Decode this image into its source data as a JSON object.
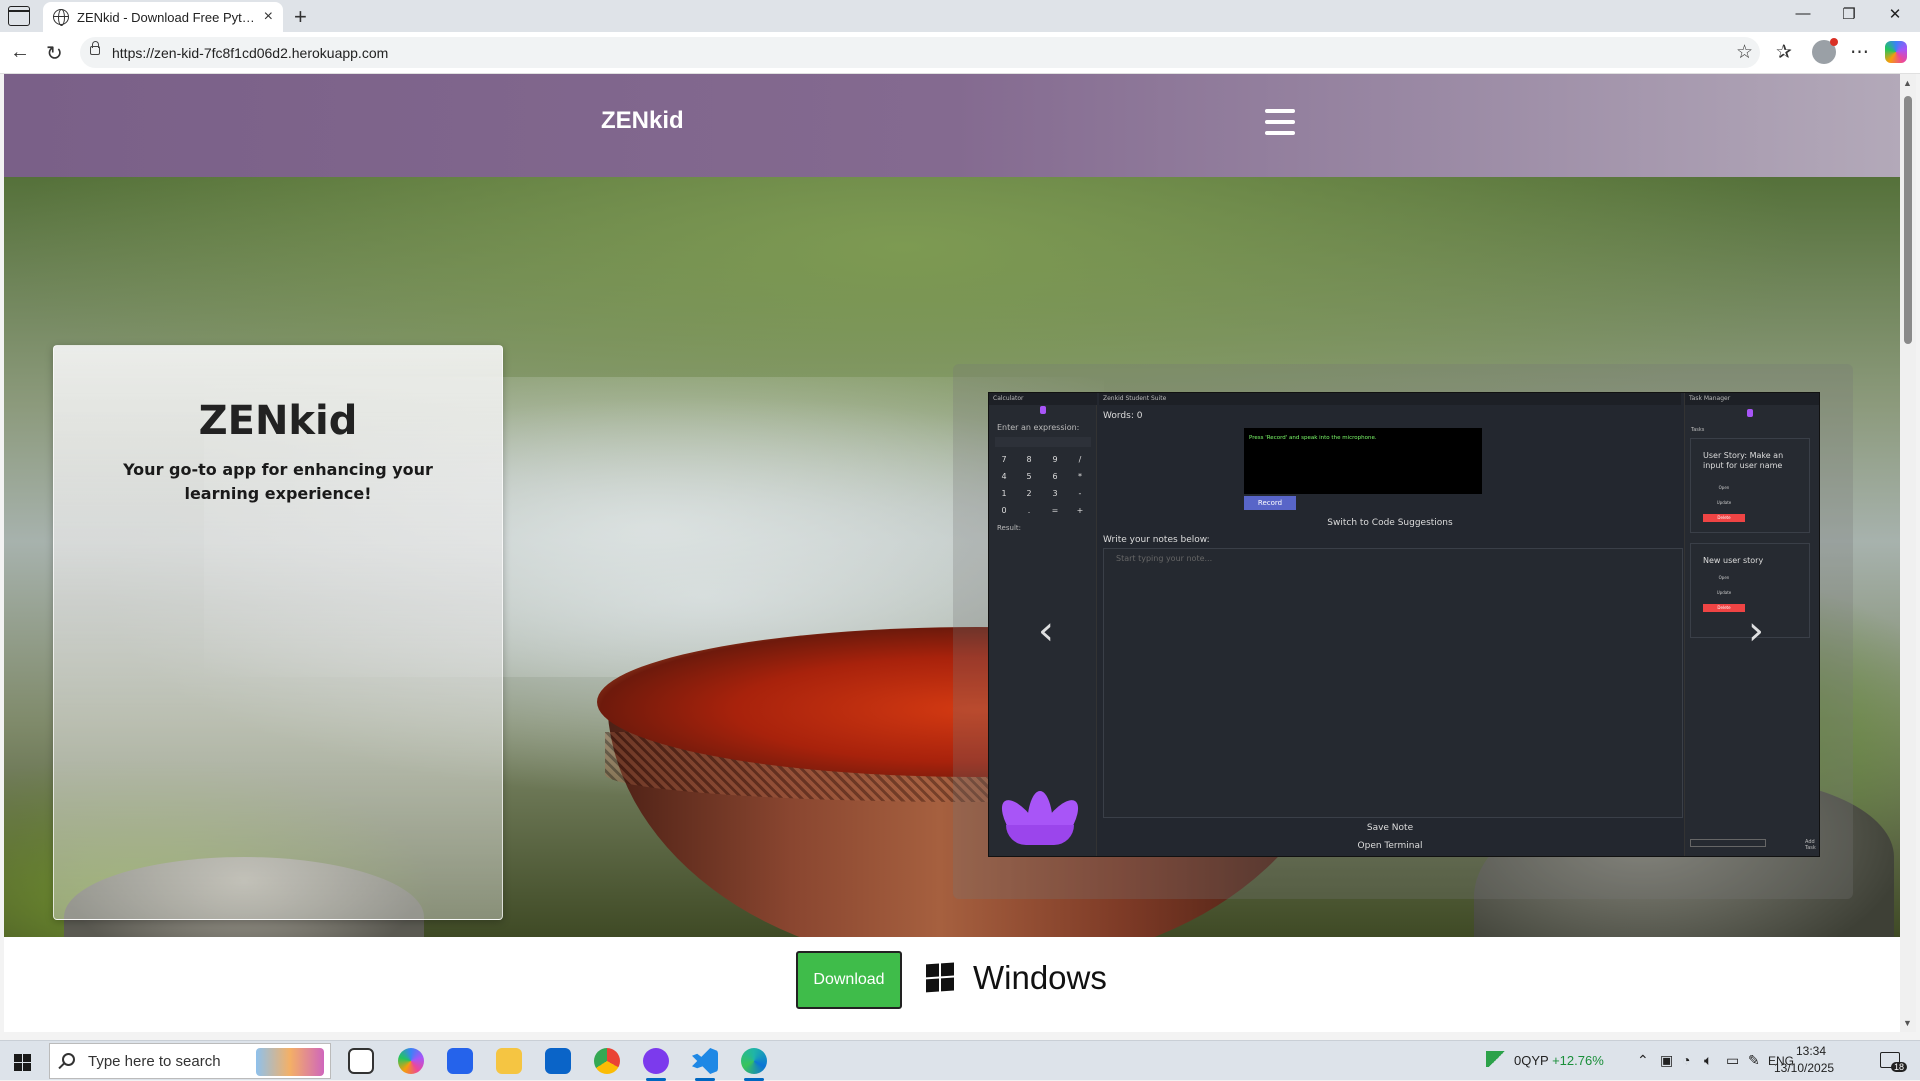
{
  "browser": {
    "tab_title": "ZENkid - Download Free Python E",
    "url": "https://zen-kid-7fc8f1cd06d2.herokuapp.com",
    "new_tab_label": "+",
    "close_tab_label": "×"
  },
  "site": {
    "logo": "ZENkid",
    "intro": {
      "title": "ZENkid",
      "tagline": "Your go-to app for enhancing your learning experience!"
    },
    "carousel": {
      "prev_label": "‹",
      "next_label": "›",
      "app_screenshot": {
        "calculator": {
          "window_title": "Calculator",
          "expression_label": "Enter an expression:",
          "keys": [
            "7",
            "8",
            "9",
            "/",
            "4",
            "5",
            "6",
            "*",
            "1",
            "2",
            "3",
            "-",
            "0",
            ".",
            "=",
            "+"
          ],
          "result_label": "Result:"
        },
        "suite": {
          "window_title": "Zenkid Student Suite",
          "words_label": "Words: 0",
          "mic_prompt": "Press 'Record' and speak into the microphone.",
          "record_label": "Record",
          "switch_label": "Switch to Code Suggestions",
          "notes_label": "Write your notes below:",
          "notes_placeholder": "Start typing your note...",
          "save_label": "Save Note",
          "terminal_label": "Open Terminal"
        },
        "task_manager": {
          "window_title": "Task Manager",
          "tasks_label": "Tasks",
          "tasks": [
            {
              "title": "User Story: Make an input for user name",
              "open": "Open",
              "update": "Update",
              "delete": "Delete"
            },
            {
              "title": "New user story",
              "open": "Open",
              "update": "Update",
              "delete": "Delete"
            }
          ],
          "add_label": "Add Task"
        }
      }
    },
    "download": {
      "button_label": "Download",
      "platform_label": "Windows"
    }
  },
  "taskbar": {
    "search_placeholder": "Type here to search",
    "stock_ticker": "0QYP",
    "stock_change": "+12.76%",
    "language": "ENG",
    "time": "13:34",
    "date": "13/10/2025",
    "notification_count": "18"
  },
  "colors": {
    "header_purple": "#7a6088",
    "download_green": "#3fbc4a",
    "lotus_purple": "#a855f7",
    "record_blue": "#5865c8",
    "delete_red": "#ef4444"
  }
}
